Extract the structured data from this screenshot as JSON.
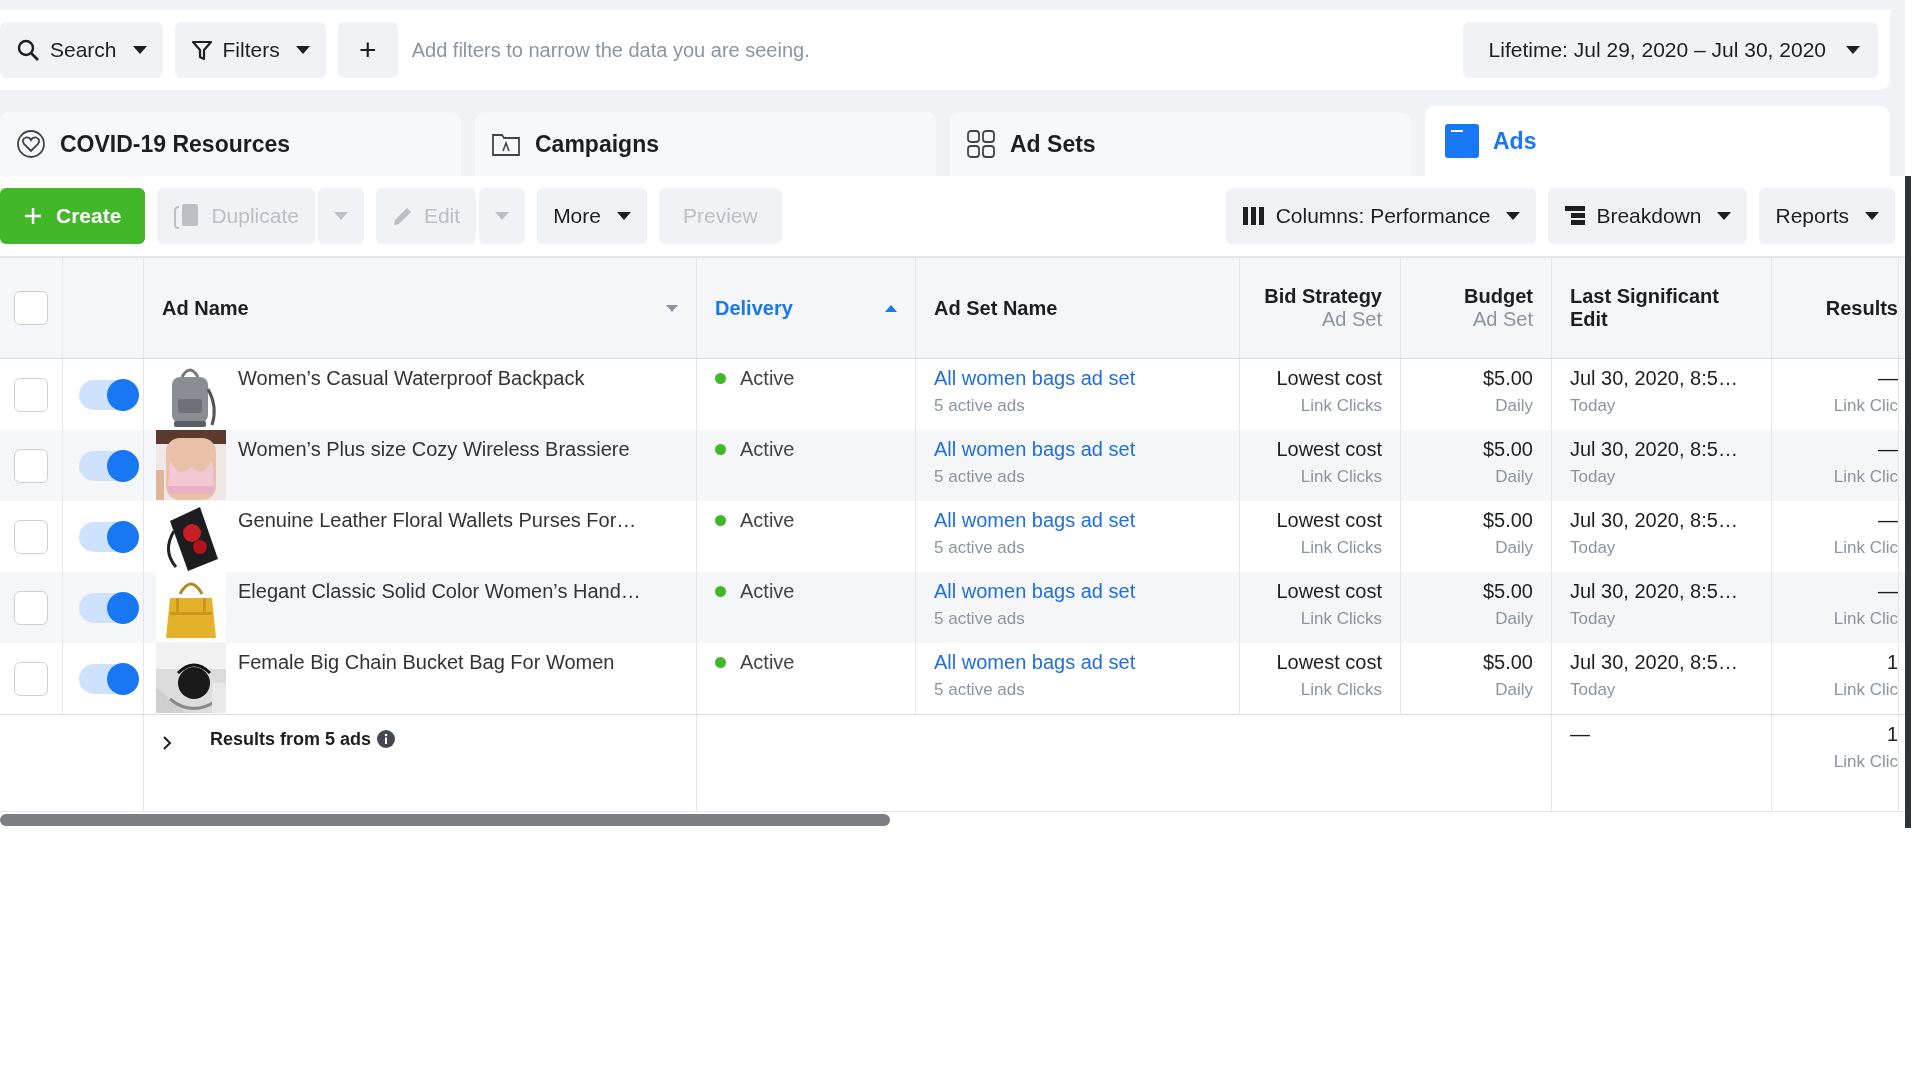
{
  "filter_bar": {
    "search": "Search",
    "filters": "Filters",
    "add": "+",
    "placeholder": "Add filters to narrow the data you are seeing.",
    "date_range": "Lifetime: Jul 29, 2020 – Jul 30, 2020"
  },
  "tabs": [
    {
      "label": "COVID-19 Resources",
      "selected": false
    },
    {
      "label": "Campaigns",
      "selected": false
    },
    {
      "label": "Ad Sets",
      "selected": false
    },
    {
      "label": "Ads",
      "selected": true
    }
  ],
  "toolbar": {
    "create": {
      "label": "Create"
    },
    "duplicate": {
      "label": "Duplicate",
      "disabled": true
    },
    "edit": {
      "label": "Edit",
      "disabled": true
    },
    "more": {
      "label": "More"
    },
    "preview": {
      "label": "Preview",
      "disabled": true
    },
    "columns": {
      "label": "Columns: Performance"
    },
    "breakdown": {
      "label": "Breakdown"
    },
    "reports": {
      "label": "Reports"
    }
  },
  "table": {
    "select_all_checked": false,
    "columns": [
      {
        "label": "Ad Name",
        "ascending": false,
        "selected": false
      },
      {
        "label": "Delivery",
        "ascending": true,
        "selected": true
      },
      {
        "label": "Ad Set Name",
        "selected": false
      },
      {
        "label": "Bid Strategy",
        "sublabel": "Ad Set",
        "selected": false
      },
      {
        "label": "Budget",
        "sublabel": "Ad Set",
        "selected": false
      },
      {
        "label": "Last Significant Edit",
        "selected": false
      },
      {
        "label": "Results",
        "selected": false
      }
    ],
    "rows": [
      {
        "checked": false,
        "on": true,
        "name": "Women’s Casual Waterproof Backpack",
        "delivery": "Active",
        "ad_set": "All women bags ad set",
        "ad_set_note": "5 active ads",
        "bid": "Lowest cost",
        "bid_note": "Link Clicks",
        "budget": "$5.00",
        "budget_note": "Daily",
        "edit": "Jul 30, 2020, 8:5…",
        "edit_note": "Today",
        "results": "—",
        "results_note": "Link Clic"
      },
      {
        "checked": false,
        "on": true,
        "name": "Women’s Plus size Cozy Wireless Brassiere",
        "delivery": "Active",
        "ad_set": "All women bags ad set",
        "ad_set_note": "5 active ads",
        "bid": "Lowest cost",
        "bid_note": "Link Clicks",
        "budget": "$5.00",
        "budget_note": "Daily",
        "edit": "Jul 30, 2020, 8:5…",
        "edit_note": "Today",
        "results": "—",
        "results_note": "Link Clic"
      },
      {
        "checked": false,
        "on": true,
        "name": "Genuine Leather Floral Wallets Purses For…",
        "delivery": "Active",
        "ad_set": "All women bags ad set",
        "ad_set_note": "5 active ads",
        "bid": "Lowest cost",
        "bid_note": "Link Clicks",
        "budget": "$5.00",
        "budget_note": "Daily",
        "edit": "Jul 30, 2020, 8:5…",
        "edit_note": "Today",
        "results": "—",
        "results_note": "Link Clic"
      },
      {
        "checked": false,
        "on": true,
        "name": "Elegant Classic Solid Color Women’s Hand…",
        "delivery": "Active",
        "ad_set": "All women bags ad set",
        "ad_set_note": "5 active ads",
        "bid": "Lowest cost",
        "bid_note": "Link Clicks",
        "budget": "$5.00",
        "budget_note": "Daily",
        "edit": "Jul 30, 2020, 8:5…",
        "edit_note": "Today",
        "results": "—",
        "results_note": "Link Clic"
      },
      {
        "checked": false,
        "on": true,
        "name": "Female Big Chain Bucket Bag For Women",
        "delivery": "Active",
        "ad_set": "All women bags ad set",
        "ad_set_note": "5 active ads",
        "bid": "Lowest cost",
        "bid_note": "Link Clicks",
        "budget": "$5.00",
        "budget_note": "Daily",
        "edit": "Jul 30, 2020, 8:5…",
        "edit_note": "Today",
        "results": "1",
        "results_note": "Link Clic"
      }
    ],
    "footer": {
      "label": "Results from 5 ads",
      "edit": "—",
      "results": "1",
      "results_note": "Link Clic"
    }
  }
}
